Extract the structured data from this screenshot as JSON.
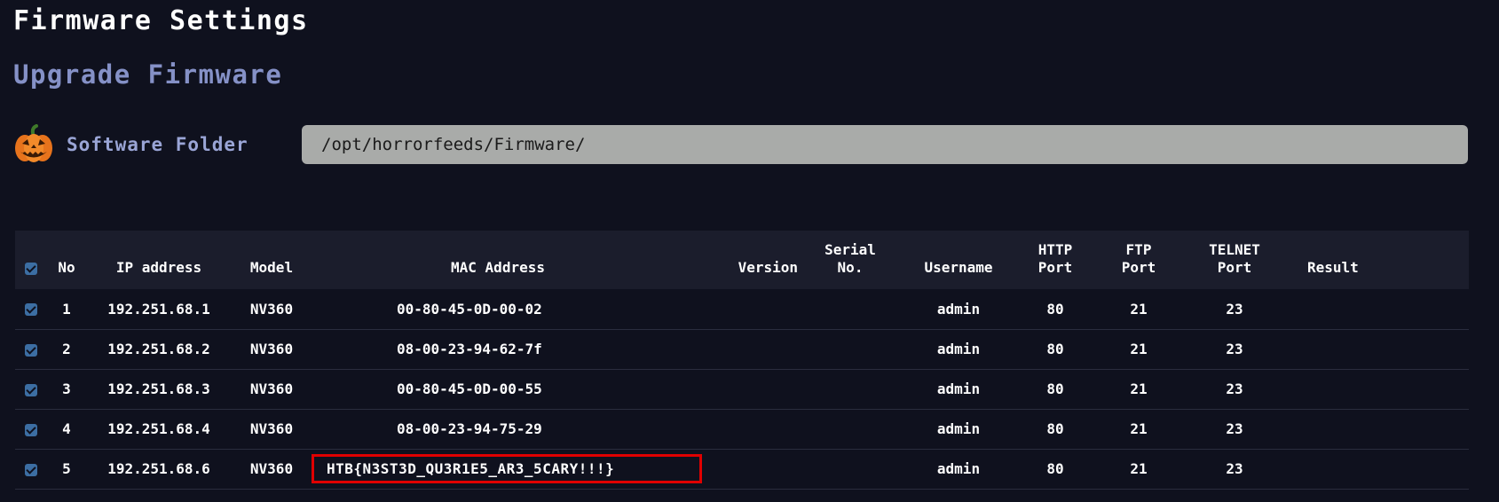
{
  "page": {
    "title": "Firmware Settings",
    "section_title": "Upgrade Firmware"
  },
  "folder": {
    "icon": "pumpkin-icon",
    "label": "Software Folder",
    "value": "/opt/horrorfeeds/Firmware/"
  },
  "table": {
    "columns": [
      "No",
      "IP address",
      "Model",
      "MAC Address",
      "Version",
      "Serial\nNo.",
      "Username",
      "HTTP\nPort",
      "FTP\nPort",
      "TELNET\nPort",
      "Result"
    ],
    "rows": [
      {
        "no": "1",
        "ip": "192.251.68.1",
        "model": "NV360",
        "mac": "00-80-45-0D-00-02",
        "version": "",
        "serial": "",
        "username": "admin",
        "http": "80",
        "ftp": "21",
        "telnet": "23",
        "result": ""
      },
      {
        "no": "2",
        "ip": "192.251.68.2",
        "model": "NV360",
        "mac": "08-00-23-94-62-7f",
        "version": "",
        "serial": "",
        "username": "admin",
        "http": "80",
        "ftp": "21",
        "telnet": "23",
        "result": ""
      },
      {
        "no": "3",
        "ip": "192.251.68.3",
        "model": "NV360",
        "mac": "00-80-45-0D-00-55",
        "version": "",
        "serial": "",
        "username": "admin",
        "http": "80",
        "ftp": "21",
        "telnet": "23",
        "result": ""
      },
      {
        "no": "4",
        "ip": "192.251.68.4",
        "model": "NV360",
        "mac": "08-00-23-94-75-29",
        "version": "",
        "serial": "",
        "username": "admin",
        "http": "80",
        "ftp": "21",
        "telnet": "23",
        "result": ""
      },
      {
        "no": "5",
        "ip": "192.251.68.6",
        "model": "NV360",
        "mac": "HTB{N3ST3D_QU3R1E5_AR3_5CARY!!!}",
        "version": "",
        "serial": "",
        "username": "admin",
        "http": "80",
        "ftp": "21",
        "telnet": "23",
        "result": ""
      }
    ]
  },
  "colors": {
    "background": "#0f111e",
    "header_row": "#1b1d2c",
    "subtitle": "#8591c7",
    "input_bg": "#a9aba9",
    "checkbox": "#3c6ea3",
    "highlight_border": "#e00000"
  }
}
